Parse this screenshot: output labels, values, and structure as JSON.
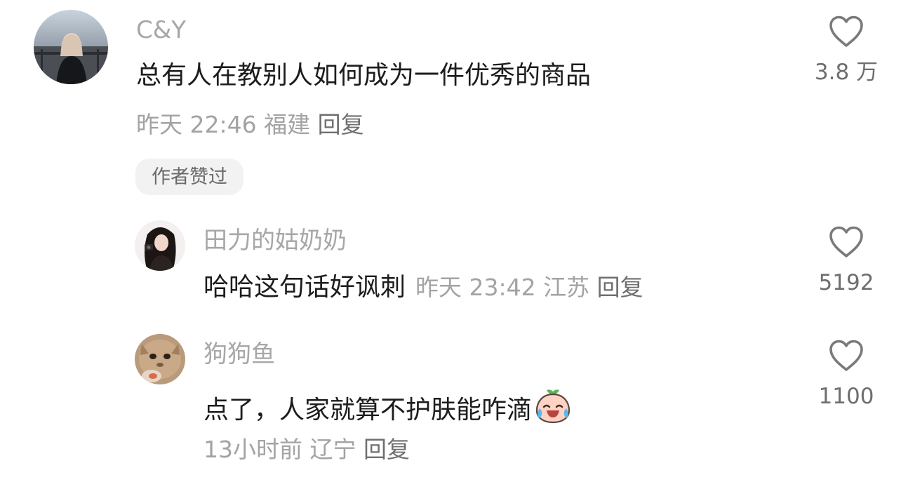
{
  "comments": [
    {
      "username": "C&Y",
      "text": "总有人在教别人如何成为一件优秀的商品",
      "time": "昨天 22:46",
      "location": "福建",
      "reply_label": "回复",
      "likes": "3.8 万",
      "badge": "作者赞过"
    }
  ],
  "replies": [
    {
      "username": "田力的姑奶奶",
      "text": "哈哈这句话好讽刺",
      "time": "昨天 23:42",
      "location": "江苏",
      "reply_label": "回复",
      "likes": "5192"
    },
    {
      "username": "狗狗鱼",
      "text": "点了，人家就算不护肤能咋滴",
      "emoji": "crying-laughing-peach-emoji",
      "time": "13小时前",
      "location": "辽宁",
      "reply_label": "回复",
      "likes": "1100"
    }
  ],
  "icons": {
    "like": "heart-outline-icon"
  },
  "colors": {
    "username": "#a7a7a7",
    "text": "#1c1c1c",
    "meta": "#a3a3a3",
    "badge_bg": "#f2f2f2"
  }
}
